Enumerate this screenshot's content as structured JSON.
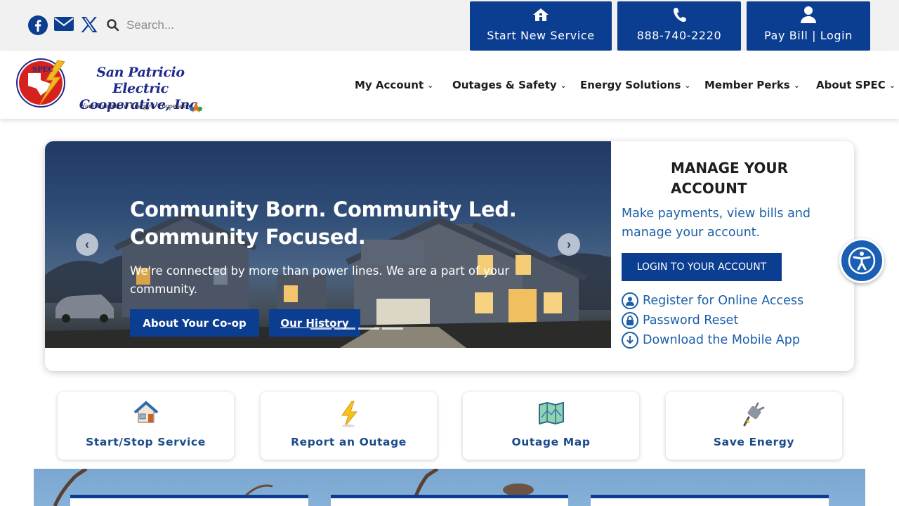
{
  "topbar": {
    "search_placeholder": "Search...",
    "quick_buttons": [
      {
        "label": "Start New Service",
        "icon": "home-icon"
      },
      {
        "label": "888-740-2220",
        "icon": "phone-icon"
      },
      {
        "label": "Pay Bill | Login",
        "icon": "user-icon"
      }
    ],
    "social_icons": [
      "facebook-icon",
      "email-icon",
      "x-icon"
    ]
  },
  "logo": {
    "letters": "SPEC",
    "name_line1": "San Patricio Electric",
    "name_line2": "Cooperative, Inc.",
    "tagline": "Your Touchstone Energy® Cooperative"
  },
  "nav": [
    "My Account",
    "Outages & Safety",
    "Energy Solutions",
    "Member Perks",
    "About SPEC"
  ],
  "hero": {
    "title": "Community Born. Community Led. Community Focused.",
    "text": "We're connected by more than power lines. We are a part of your community.",
    "buttons": [
      "About Your Co-op",
      "Our History"
    ]
  },
  "manage": {
    "title": "MANAGE YOUR ACCOUNT",
    "description": "Make payments, view bills and manage your account.",
    "login_button": "LOGIN TO YOUR ACCOUNT",
    "links": [
      "Register for Online Access",
      "Password Reset",
      "Download the Mobile App"
    ]
  },
  "quick_links": [
    {
      "label": "Start/Stop Service",
      "icon": "house-icon"
    },
    {
      "label": "Report an Outage",
      "icon": "lightning-icon"
    },
    {
      "label": "Outage Map",
      "icon": "map-icon"
    },
    {
      "label": "Save Energy",
      "icon": "plug-icon"
    }
  ],
  "colors": {
    "primary_blue": "#0b3d91",
    "link_blue": "#1b5fa8",
    "topbar_bg": "#f1f1f1",
    "accessibility_blue": "#1a5fb4"
  }
}
